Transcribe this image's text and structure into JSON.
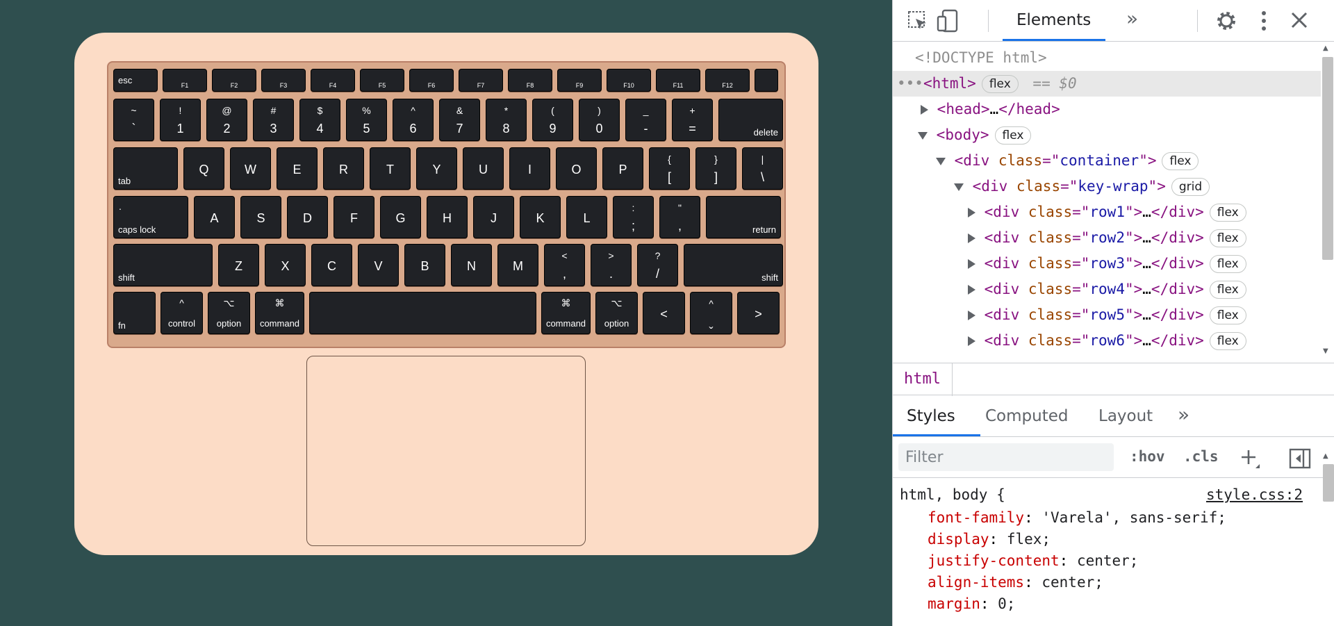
{
  "keyboard": {
    "row1": [
      "esc",
      "F1",
      "F2",
      "F3",
      "F4",
      "F5",
      "F6",
      "F7",
      "F8",
      "F9",
      "F10",
      "F11",
      "F12",
      ""
    ],
    "row2": [
      {
        "top": "~",
        "bottom": "`"
      },
      {
        "top": "!",
        "bottom": "1"
      },
      {
        "top": "@",
        "bottom": "2"
      },
      {
        "top": "#",
        "bottom": "3"
      },
      {
        "top": "$",
        "bottom": "4"
      },
      {
        "top": "%",
        "bottom": "5"
      },
      {
        "top": "^",
        "bottom": "6"
      },
      {
        "top": "&",
        "bottom": "7"
      },
      {
        "top": "*",
        "bottom": "8"
      },
      {
        "top": "(",
        "bottom": "9"
      },
      {
        "top": ")",
        "bottom": "0"
      },
      {
        "top": "_",
        "bottom": "-"
      },
      {
        "top": "+",
        "bottom": "="
      },
      {
        "label": "delete"
      }
    ],
    "row3": [
      {
        "label": "tab"
      },
      {
        "letter": "Q"
      },
      {
        "letter": "W"
      },
      {
        "letter": "E"
      },
      {
        "letter": "R"
      },
      {
        "letter": "T"
      },
      {
        "letter": "Y"
      },
      {
        "letter": "U"
      },
      {
        "letter": "I"
      },
      {
        "letter": "O"
      },
      {
        "letter": "P"
      },
      {
        "top": "{",
        "bottom": "["
      },
      {
        "top": "}",
        "bottom": "]"
      },
      {
        "top": "|",
        "bottom": "\\"
      }
    ],
    "row4": [
      {
        "top": ".",
        "label": "caps lock"
      },
      {
        "letter": "A"
      },
      {
        "letter": "S"
      },
      {
        "letter": "D"
      },
      {
        "letter": "F"
      },
      {
        "letter": "G"
      },
      {
        "letter": "H"
      },
      {
        "letter": "J"
      },
      {
        "letter": "K"
      },
      {
        "letter": "L"
      },
      {
        "top": ":",
        "bottom": ";"
      },
      {
        "top": "\"",
        "bottom": ","
      },
      {
        "label": "return"
      }
    ],
    "row5": [
      {
        "label": "shift"
      },
      {
        "letter": "Z"
      },
      {
        "letter": "X"
      },
      {
        "letter": "C"
      },
      {
        "letter": "V"
      },
      {
        "letter": "B"
      },
      {
        "letter": "N"
      },
      {
        "letter": "M"
      },
      {
        "top": "<",
        "bottom": ","
      },
      {
        "top": ">",
        "bottom": "."
      },
      {
        "top": "?",
        "bottom": "/"
      },
      {
        "label": "shift"
      }
    ],
    "row6": [
      {
        "label": "fn"
      },
      {
        "top": "^",
        "label": "control"
      },
      {
        "top": "⌥",
        "label": "option"
      },
      {
        "top": "⌘",
        "label": "command"
      },
      {
        "label": ""
      },
      {
        "top": "⌘",
        "label": "command"
      },
      {
        "top": "⌥",
        "label": "option"
      },
      {
        "letter": "<"
      },
      {
        "top": "^",
        "bottom": "ˬ"
      },
      {
        "letter": ">"
      }
    ]
  },
  "devtools": {
    "tab_elements": "Elements",
    "more_tabs": "»",
    "dom": {
      "doctype": "<!DOCTYPE html>",
      "selected_suffix": "== $0",
      "flex": "flex",
      "grid": "grid",
      "html": "html",
      "head": "head",
      "body": "body",
      "ellipsis": "…",
      "container_class": "container",
      "keywrap_class": "key-wrap",
      "rows": [
        "row1",
        "row2",
        "row3",
        "row4",
        "row5",
        "row6"
      ]
    },
    "breadcrumb": "html",
    "styles_tabs": [
      "Styles",
      "Computed",
      "Layout"
    ],
    "filter_placeholder": "Filter",
    "hov": ":hov",
    "cls": ".cls",
    "css_rule": {
      "selector": "html, body {",
      "source": "style.css:2",
      "props": [
        {
          "name": "font-family",
          "value": "'Varela', sans-serif;"
        },
        {
          "name": "display",
          "value": "flex;"
        },
        {
          "name": "justify-content",
          "value": "center;"
        },
        {
          "name": "align-items",
          "value": "center;"
        },
        {
          "name": "margin",
          "value": "0;"
        }
      ]
    }
  }
}
